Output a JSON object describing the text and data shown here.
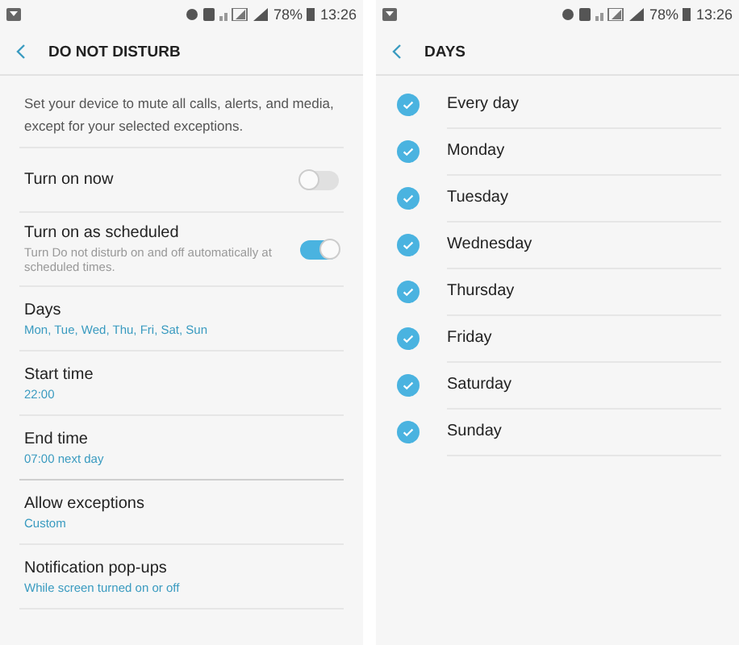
{
  "screens": [
    {
      "status_bar": {
        "battery": "78%",
        "time": "13:26"
      },
      "title": "DO NOT DISTURB",
      "description": "Set your device to mute all calls, alerts, and media, except for your selected exceptions.",
      "settings": [
        {
          "kind": "toggle",
          "label": "Turn on now",
          "on": false
        },
        {
          "kind": "toggle",
          "label": "Turn on as scheduled",
          "summary": "Turn Do not disturb on and off automatically at scheduled times.",
          "on": true
        },
        {
          "kind": "value",
          "label": "Days",
          "value": "Mon, Tue, Wed, Thu, Fri, Sat, Sun"
        },
        {
          "kind": "value",
          "label": "Start time",
          "value": "22:00"
        },
        {
          "kind": "value",
          "label": "End time",
          "value": "07:00 next day",
          "group_end": true
        },
        {
          "kind": "value",
          "label": "Allow exceptions",
          "value": "Custom"
        },
        {
          "kind": "value",
          "label": "Notification pop-ups",
          "value": "While screen turned on or off"
        }
      ]
    },
    {
      "status_bar": {
        "battery": "78%",
        "time": "13:26"
      },
      "title": "DAYS",
      "days": [
        {
          "label": "Every day",
          "checked": true
        },
        {
          "label": "Monday",
          "checked": true
        },
        {
          "label": "Tuesday",
          "checked": true
        },
        {
          "label": "Wednesday",
          "checked": true
        },
        {
          "label": "Thursday",
          "checked": true
        },
        {
          "label": "Friday",
          "checked": true
        },
        {
          "label": "Saturday",
          "checked": true
        },
        {
          "label": "Sunday",
          "checked": true
        }
      ]
    }
  ]
}
